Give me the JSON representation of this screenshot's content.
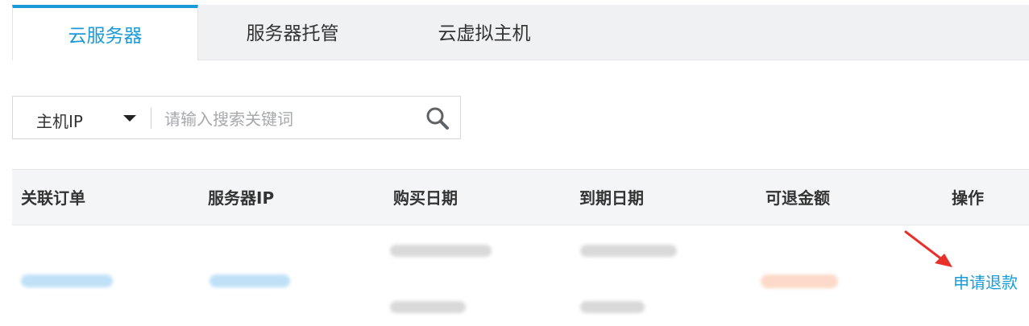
{
  "tabs": [
    {
      "label": "云服务器",
      "active": true
    },
    {
      "label": "服务器托管",
      "active": false
    },
    {
      "label": "云虚拟主机",
      "active": false
    }
  ],
  "search": {
    "filter_selected": "主机IP",
    "placeholder": "请输入搜索关键词",
    "search_icon": "search-icon",
    "caret_icon": "caret-down-icon"
  },
  "table": {
    "columns": [
      "关联订单",
      "服务器IP",
      "购买日期",
      "到期日期",
      "可退金额",
      "操作"
    ],
    "rows": [
      {
        "action_label": "申请退款"
      }
    ]
  },
  "annotation": {
    "arrow_color": "#e8302a"
  },
  "colors": {
    "accent": "#1a9bd8",
    "tab_bar_bg": "#f0f1f2",
    "table_header_bg": "#f4f5f6"
  }
}
